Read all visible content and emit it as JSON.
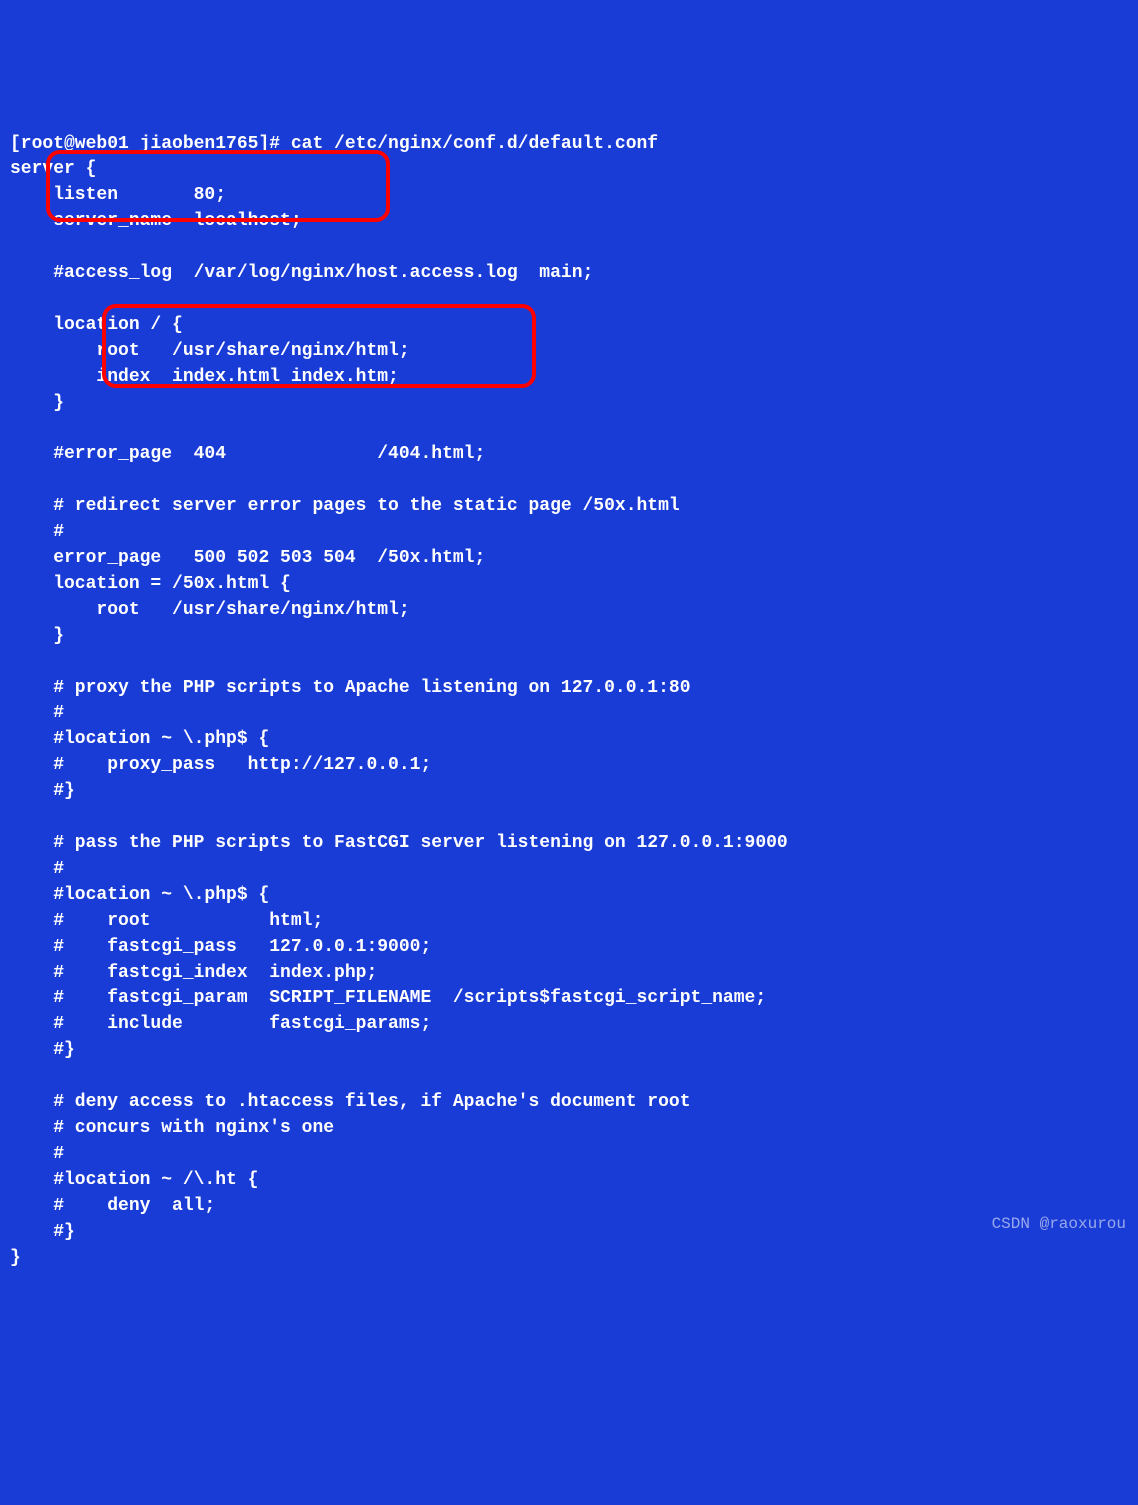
{
  "terminal": {
    "lines": [
      "[root@web01 jiaoben1765]# cat /etc/nginx/conf.d/default.conf",
      "server {",
      "    listen       80;",
      "    server_name  localhost;",
      "",
      "    #access_log  /var/log/nginx/host.access.log  main;",
      "",
      "    location / {",
      "        root   /usr/share/nginx/html;",
      "        index  index.html index.htm;",
      "    }",
      "",
      "    #error_page  404              /404.html;",
      "",
      "    # redirect server error pages to the static page /50x.html",
      "    #",
      "    error_page   500 502 503 504  /50x.html;",
      "    location = /50x.html {",
      "        root   /usr/share/nginx/html;",
      "    }",
      "",
      "    # proxy the PHP scripts to Apache listening on 127.0.0.1:80",
      "    #",
      "    #location ~ \\.php$ {",
      "    #    proxy_pass   http://127.0.0.1;",
      "    #}",
      "",
      "    # pass the PHP scripts to FastCGI server listening on 127.0.0.1:9000",
      "    #",
      "    #location ~ \\.php$ {",
      "    #    root           html;",
      "    #    fastcgi_pass   127.0.0.1:9000;",
      "    #    fastcgi_index  index.php;",
      "    #    fastcgi_param  SCRIPT_FILENAME  /scripts$fastcgi_script_name;",
      "    #    include        fastcgi_params;",
      "    #}",
      "",
      "    # deny access to .htaccess files, if Apache's document root",
      "    # concurs with nginx's one",
      "    #",
      "    #location ~ /\\.ht {",
      "    #    deny  all;",
      "    #}",
      "}"
    ]
  },
  "watermark": "CSDN @raoxurou"
}
